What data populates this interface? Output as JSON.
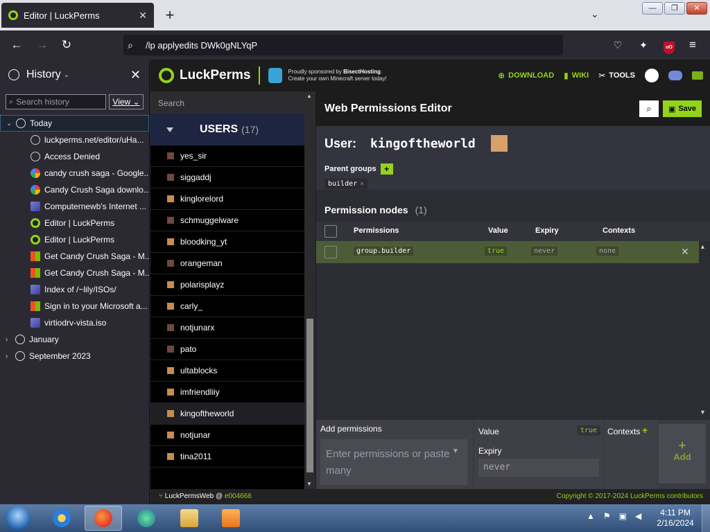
{
  "tab": {
    "title": "Editor | LuckPerms",
    "close": "✕",
    "new_tab": "+",
    "list_tabs": "⌄"
  },
  "window": {
    "minimize": "—",
    "maximize": "❐",
    "close": "✕"
  },
  "nav": {
    "back": "←",
    "forward": "→",
    "reload": "↻",
    "url": "/lp applyedits DWk0gNLYqP",
    "menu": "≡"
  },
  "sidebar": {
    "title": "History",
    "search_placeholder": "Search history",
    "view_label": "View",
    "groups": [
      {
        "label": "Today",
        "expanded": true
      },
      {
        "label": "January",
        "expanded": false
      },
      {
        "label": "September 2023",
        "expanded": false
      }
    ],
    "items": [
      {
        "label": "luckperms.net/editor/uHa...",
        "icon": "globe-icon"
      },
      {
        "label": "Access Denied",
        "icon": "globe-icon"
      },
      {
        "label": "candy crush saga - Google...",
        "icon": "google-icon"
      },
      {
        "label": "Candy Crush Saga downlo...",
        "icon": "google-icon"
      },
      {
        "label": "Computernewb's Internet ...",
        "icon": "computernewb-icon"
      },
      {
        "label": "Editor | LuckPerms",
        "icon": "luckperms-icon"
      },
      {
        "label": "Editor | LuckPerms",
        "icon": "luckperms-icon"
      },
      {
        "label": "Get Candy Crush Saga - M...",
        "icon": "microsoft-icon"
      },
      {
        "label": "Get Candy Crush Saga - M...",
        "icon": "microsoft-icon"
      },
      {
        "label": "Index of /~lily/ISOs/",
        "icon": "computernewb-icon"
      },
      {
        "label": "Sign in to your Microsoft a...",
        "icon": "microsoft-icon"
      },
      {
        "label": "virtiodrv-vista.iso",
        "icon": "computernewb-icon"
      }
    ]
  },
  "lp": {
    "brand": "LuckPerms",
    "sponsor_line1_prefix": "Proudly sponsored by ",
    "sponsor_name": "BisectHosting",
    "sponsor_line1_suffix": ".",
    "sponsor_line2": "Create your own Minecraft server today!",
    "links": {
      "download": "DOWNLOAD",
      "wiki": "WIKI",
      "tools": "TOOLS"
    },
    "users_search_placeholder": "Search",
    "users_title": "USERS",
    "users_count": "(17)",
    "users": [
      {
        "name": "yes_sir",
        "skin": "dark"
      },
      {
        "name": "siggaddj",
        "skin": "dark"
      },
      {
        "name": "kinglorelord",
        "skin": "light"
      },
      {
        "name": "schmuggelware",
        "skin": "dark"
      },
      {
        "name": "bloodking_yt",
        "skin": "light"
      },
      {
        "name": "orangeman",
        "skin": "dark"
      },
      {
        "name": "polarisplayz",
        "skin": "light"
      },
      {
        "name": "carly_",
        "skin": "light"
      },
      {
        "name": "notjunarx",
        "skin": "dark"
      },
      {
        "name": "pato",
        "skin": "dark"
      },
      {
        "name": "ultablocks",
        "skin": "light"
      },
      {
        "name": "imfriendliiy",
        "skin": "light"
      },
      {
        "name": "kingoftheworld",
        "skin": "light",
        "active": true
      },
      {
        "name": "notjunar",
        "skin": "light"
      },
      {
        "name": "tina2011",
        "skin": "light"
      }
    ],
    "editor": {
      "title": "Web Permissions Editor",
      "save_label": "Save",
      "user_label": "User:",
      "username": "kingoftheworld",
      "parent_groups_label": "Parent groups",
      "parent_groups": [
        "builder"
      ],
      "nodes_title": "Permission nodes",
      "nodes_count": "(1)",
      "columns": {
        "permissions": "Permissions",
        "value": "Value",
        "expiry": "Expiry",
        "contexts": "Contexts"
      },
      "nodes": [
        {
          "permission": "group.builder",
          "value": "true",
          "expiry": "never",
          "contexts": "none"
        }
      ],
      "add": {
        "permissions_label": "Add permissions",
        "permissions_placeholder": "Enter permissions or paste many",
        "value_label": "Value",
        "value": "true",
        "expiry_label": "Expiry",
        "expiry_value": "never",
        "contexts_label": "Contexts",
        "add_label": "Add"
      }
    },
    "footer": {
      "left_prefix": "LuckPermsWeb",
      "left_at": " @ ",
      "commit": "e004666",
      "right": "Copyright © 2017-2024 LuckPerms contributors"
    }
  },
  "taskbar": {
    "time": "4:11 PM",
    "date": "2/16/2024"
  }
}
